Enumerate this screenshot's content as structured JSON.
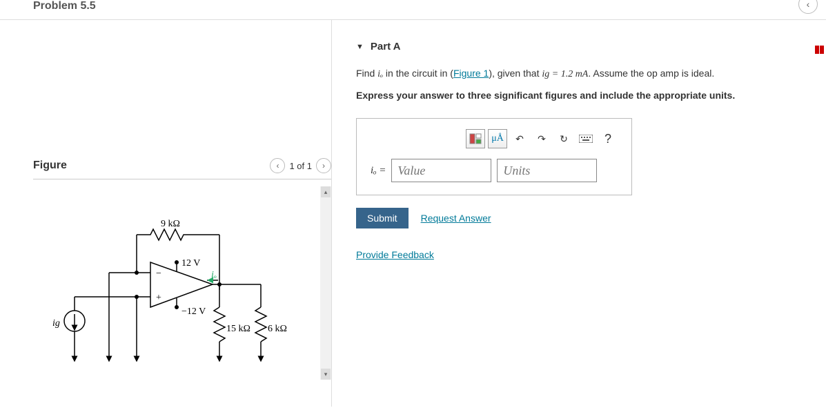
{
  "header": {
    "title": "Problem 5.5"
  },
  "figure": {
    "title": "Figure",
    "nav_text": "1 of 1",
    "labels": {
      "r_top": "9 kΩ",
      "v_pos": "12 V",
      "v_neg": "−12 V",
      "io": "iₒ",
      "ig": "ig",
      "r1": "15 kΩ",
      "r2": "6 kΩ"
    }
  },
  "partA": {
    "title": "Part A",
    "prompt_pre": "Find ",
    "prompt_var1": "iₒ",
    "prompt_mid": " in the circuit in (",
    "figure_link": "Figure 1",
    "prompt_mid2": "), given that ",
    "prompt_var2": "ig",
    "prompt_eq": " = 1.2 mA",
    "prompt_post": ". Assume the op amp is ideal.",
    "instruction": "Express your answer to three significant figures and include the appropriate units.",
    "eq_label": "iₒ  =",
    "value_placeholder": "Value",
    "units_placeholder": "Units",
    "submit": "Submit",
    "request_answer": "Request Answer",
    "feedback": "Provide Feedback",
    "toolbar": {
      "units_btn": "μÅ",
      "help": "?"
    }
  }
}
